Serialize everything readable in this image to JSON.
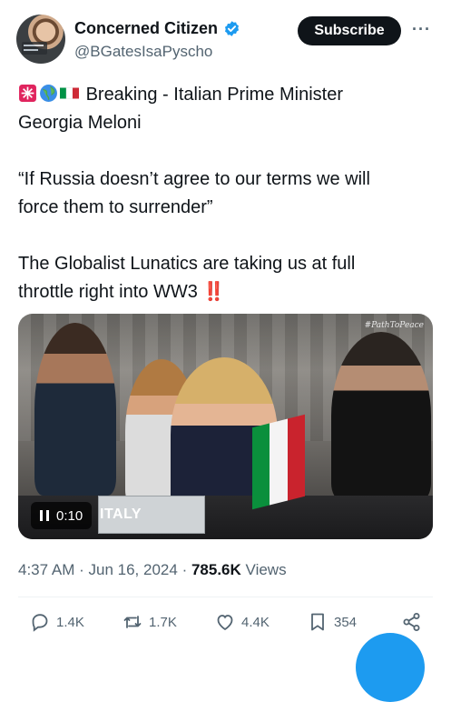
{
  "author": {
    "display_name": "Concerned Citizen",
    "handle": "@BGatesIsaPyscho",
    "verified": true,
    "avatar_icon": "avatar-photo"
  },
  "header": {
    "subscribe_label": "Subscribe",
    "more_icon": "more-icon",
    "more_label": "···"
  },
  "tweet": {
    "line1_emoji": [
      "siren-emoji",
      "globe-emoji",
      "italy-flag-emoji"
    ],
    "line1": "Breaking - Italian Prime Minister",
    "line2": "Georgia Meloni",
    "quote1": "“If Russia doesn’t agree to our terms we will",
    "quote2": "force them to surrender”",
    "comment1": "The Globalist Lunatics are taking us at full",
    "comment2": "throttle right into WW3",
    "comment2_emoji": "‼️"
  },
  "video": {
    "watermark": "#PathToPeace",
    "time": "0:10",
    "nameplate": "ITALY"
  },
  "meta": {
    "time": "4:37 AM",
    "separator": "·",
    "date": "Jun 16, 2024",
    "views_count": "785.6K",
    "views_label": "Views"
  },
  "actions": {
    "replies": "1.4K",
    "reposts": "1.7K",
    "likes": "4.4K",
    "bookmarks": "354"
  },
  "colors": {
    "accent": "#1d9bf0",
    "text": "#0f1419",
    "muted": "#536471"
  }
}
